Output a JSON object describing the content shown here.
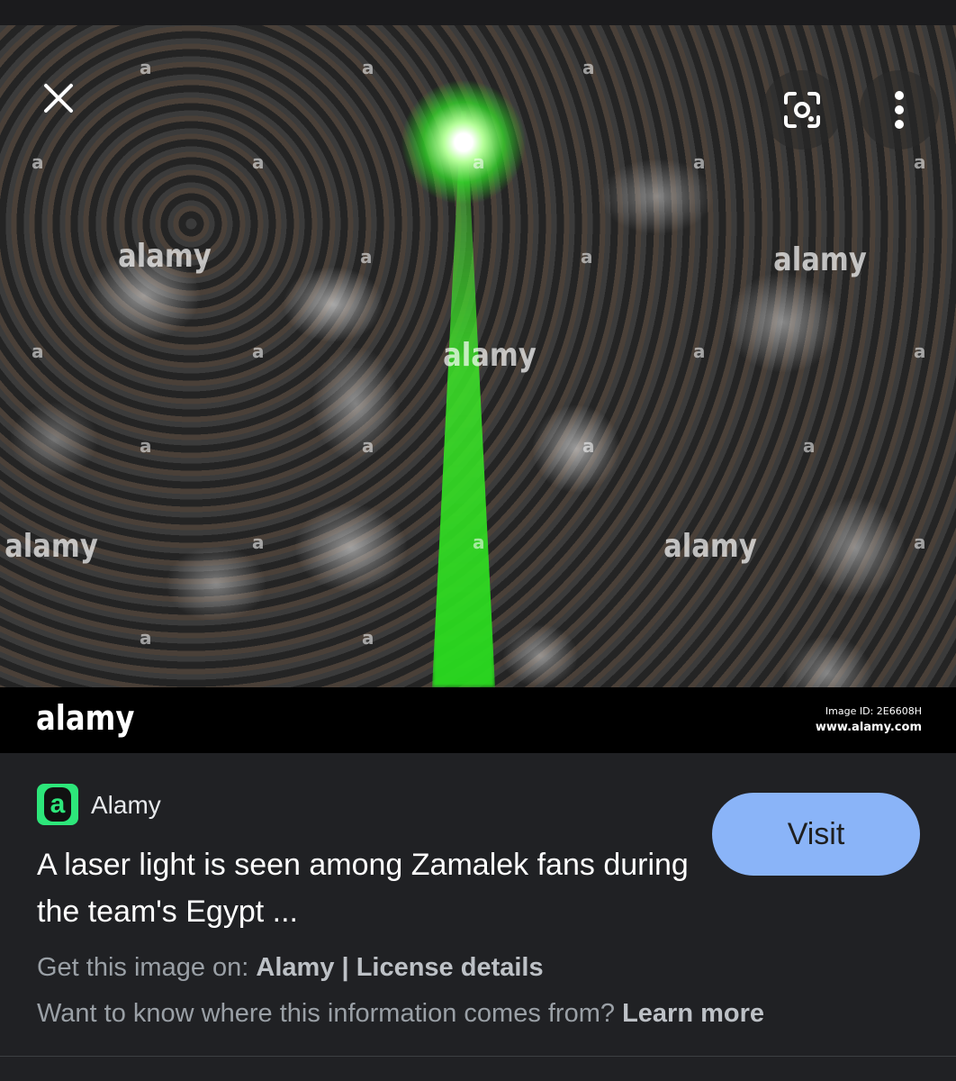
{
  "viewer": {
    "watermark_text": "alamy",
    "watermark_small": "a",
    "footer": {
      "logo": "alamy",
      "image_id": "Image ID: 2E6608H",
      "url": "www.alamy.com"
    }
  },
  "toolbar": {
    "close_icon": "close-icon",
    "lens_icon": "lens-icon",
    "more_icon": "more-vert-icon"
  },
  "result": {
    "source_icon_letter": "a",
    "source_name": "Alamy",
    "title": "A laser light is seen among Zamalek fans during the team's Egypt ...",
    "visit_label": "Visit",
    "get_prefix": "Get this image on: ",
    "get_source": "Alamy",
    "separator": " | ",
    "license_label": "License details",
    "want_text": "Want to know where this information comes from? ",
    "learn_more": "Learn more"
  },
  "colors": {
    "accent_button": "#8ab4f8",
    "laser_green": "#3be62a",
    "source_icon_bg": "#2de67a"
  }
}
